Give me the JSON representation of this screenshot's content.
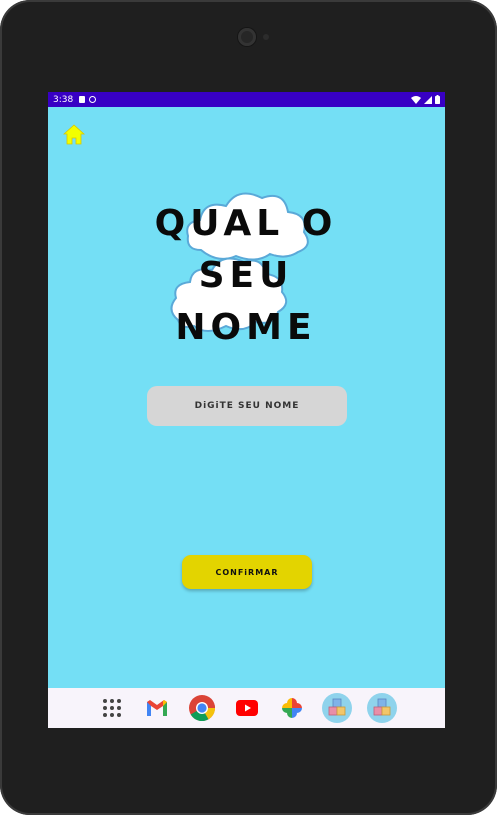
{
  "status_bar": {
    "time": "3:38",
    "left_icons": [
      "sim-card-icon",
      "media-icon"
    ],
    "right_icons": [
      "wifi-icon",
      "cell-signal-icon",
      "battery-icon"
    ],
    "color": "#3800c4"
  },
  "screen": {
    "background_color": "#74dff5"
  },
  "home_button": {
    "icon": "home-icon",
    "color": "#f2ff00"
  },
  "title": {
    "line1": "QUAL O",
    "line2": "SEU",
    "line3": "NOME"
  },
  "name_input": {
    "placeholder": "DiGiTE SEU NOME",
    "value": ""
  },
  "confirm_button": {
    "label": "CONFiRMAR",
    "color": "#e3d400"
  },
  "dock": {
    "apps": [
      {
        "icon": "app-drawer-icon"
      },
      {
        "icon": "gmail-icon"
      },
      {
        "icon": "chrome-icon"
      },
      {
        "icon": "youtube-icon"
      },
      {
        "icon": "photos-icon"
      },
      {
        "icon": "abc-blocks-app-icon"
      },
      {
        "icon": "abc-blocks-app-icon"
      }
    ]
  }
}
